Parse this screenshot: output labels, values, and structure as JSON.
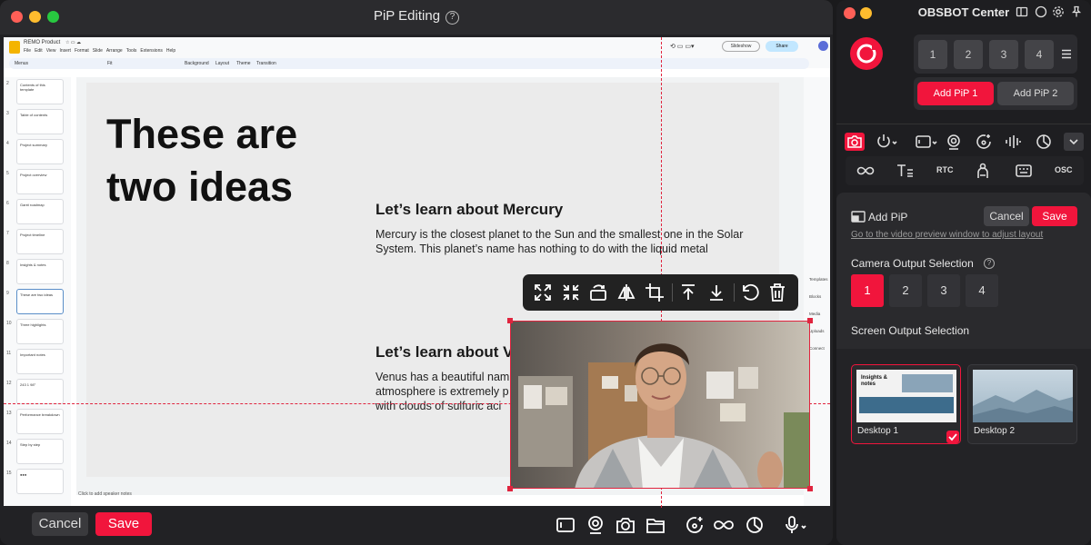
{
  "window": {
    "title": "PiP Editing",
    "help_glyph": "?"
  },
  "slides_app": {
    "doc_title": "REMO Product",
    "menu": [
      "File",
      "Edit",
      "View",
      "Insert",
      "Format",
      "Slide",
      "Arrange",
      "Tools",
      "Extensions",
      "Help"
    ],
    "toolbar": {
      "menus": "Menus",
      "zoom": "Fit",
      "background": "Background",
      "layout": "Layout",
      "theme": "Theme",
      "transition": "Transition"
    },
    "slideshow_label": "Slideshow",
    "share_label": "Share",
    "speaker_notes": "Click to add speaker notes",
    "rail": [
      "Templates",
      "Blocks",
      "Media",
      "Uploads",
      "Connect"
    ],
    "filmstrip": [
      {
        "num": "2",
        "text": "Contents of this template"
      },
      {
        "num": "3",
        "text": "Table of contents"
      },
      {
        "num": "4",
        "text": "Project summary"
      },
      {
        "num": "5",
        "text": "Project overview"
      },
      {
        "num": "6",
        "text": "Gantt roadmap"
      },
      {
        "num": "7",
        "text": "Project timeline"
      },
      {
        "num": "8",
        "text": "Insights & notes"
      },
      {
        "num": "9",
        "text": "These are two ideas"
      },
      {
        "num": "10",
        "text": "Three highlights"
      },
      {
        "num": "11",
        "text": "Important notes"
      },
      {
        "num": "12",
        "text": "243  1  98°"
      },
      {
        "num": "13",
        "text": "Performance breakdown"
      },
      {
        "num": "14",
        "text": "Step by step"
      },
      {
        "num": "15",
        "text": "●●●"
      }
    ],
    "slide": {
      "title": "These are two ideas",
      "heading1": "Let’s learn about Mercury",
      "body1": "Mercury is the closest planet to the Sun and the smallest one in the Solar System. This planet’s name has nothing to do with the liquid metal",
      "heading2": "Let’s learn about V",
      "body2": "Venus has a beautiful nam\natmosphere is extremely p\nwith clouds of sulfuric aci"
    }
  },
  "pip_toolbar": [
    "expand-icon",
    "fullscreen-icon",
    "rotate-icon",
    "flip-icon",
    "crop-icon",
    "bring-to-front-icon",
    "send-to-back-icon",
    "reset-icon",
    "delete-icon"
  ],
  "bottom_bar": {
    "cancel": "Cancel",
    "save": "Save",
    "icons": [
      "camera-frame-icon",
      "webcam-icon",
      "snapshot-icon",
      "folder-icon",
      "ai-tracking-icon",
      "infinity-icon",
      "color-icon",
      "microphone-icon"
    ]
  },
  "obsbot": {
    "title": "OBSBOT Center",
    "presets": [
      "1",
      "2",
      "3",
      "4"
    ],
    "add_pip_1": "Add PiP 1",
    "add_pip_2": "Add PiP 2",
    "toolbar_row2": {
      "rtc": "RTC",
      "osc": "OSC"
    },
    "panel": {
      "add_pip_label": "Add PiP",
      "cancel": "Cancel",
      "save": "Save",
      "hint": "Go to the video preview window to adjust layout",
      "camera_output_label": "Camera Output Selection",
      "camera_outputs": [
        "1",
        "2",
        "3",
        "4"
      ],
      "camera_selected": "1",
      "screen_output_label": "Screen Output Selection",
      "desktops": [
        {
          "name": "Desktop 1",
          "selected": true,
          "thumb_title": "Insights & notes"
        },
        {
          "name": "Desktop 2",
          "selected": false
        }
      ]
    }
  },
  "colors": {
    "accent": "#f1153c",
    "panel_bg": "#1e1e21",
    "guide": "#e0243e"
  }
}
